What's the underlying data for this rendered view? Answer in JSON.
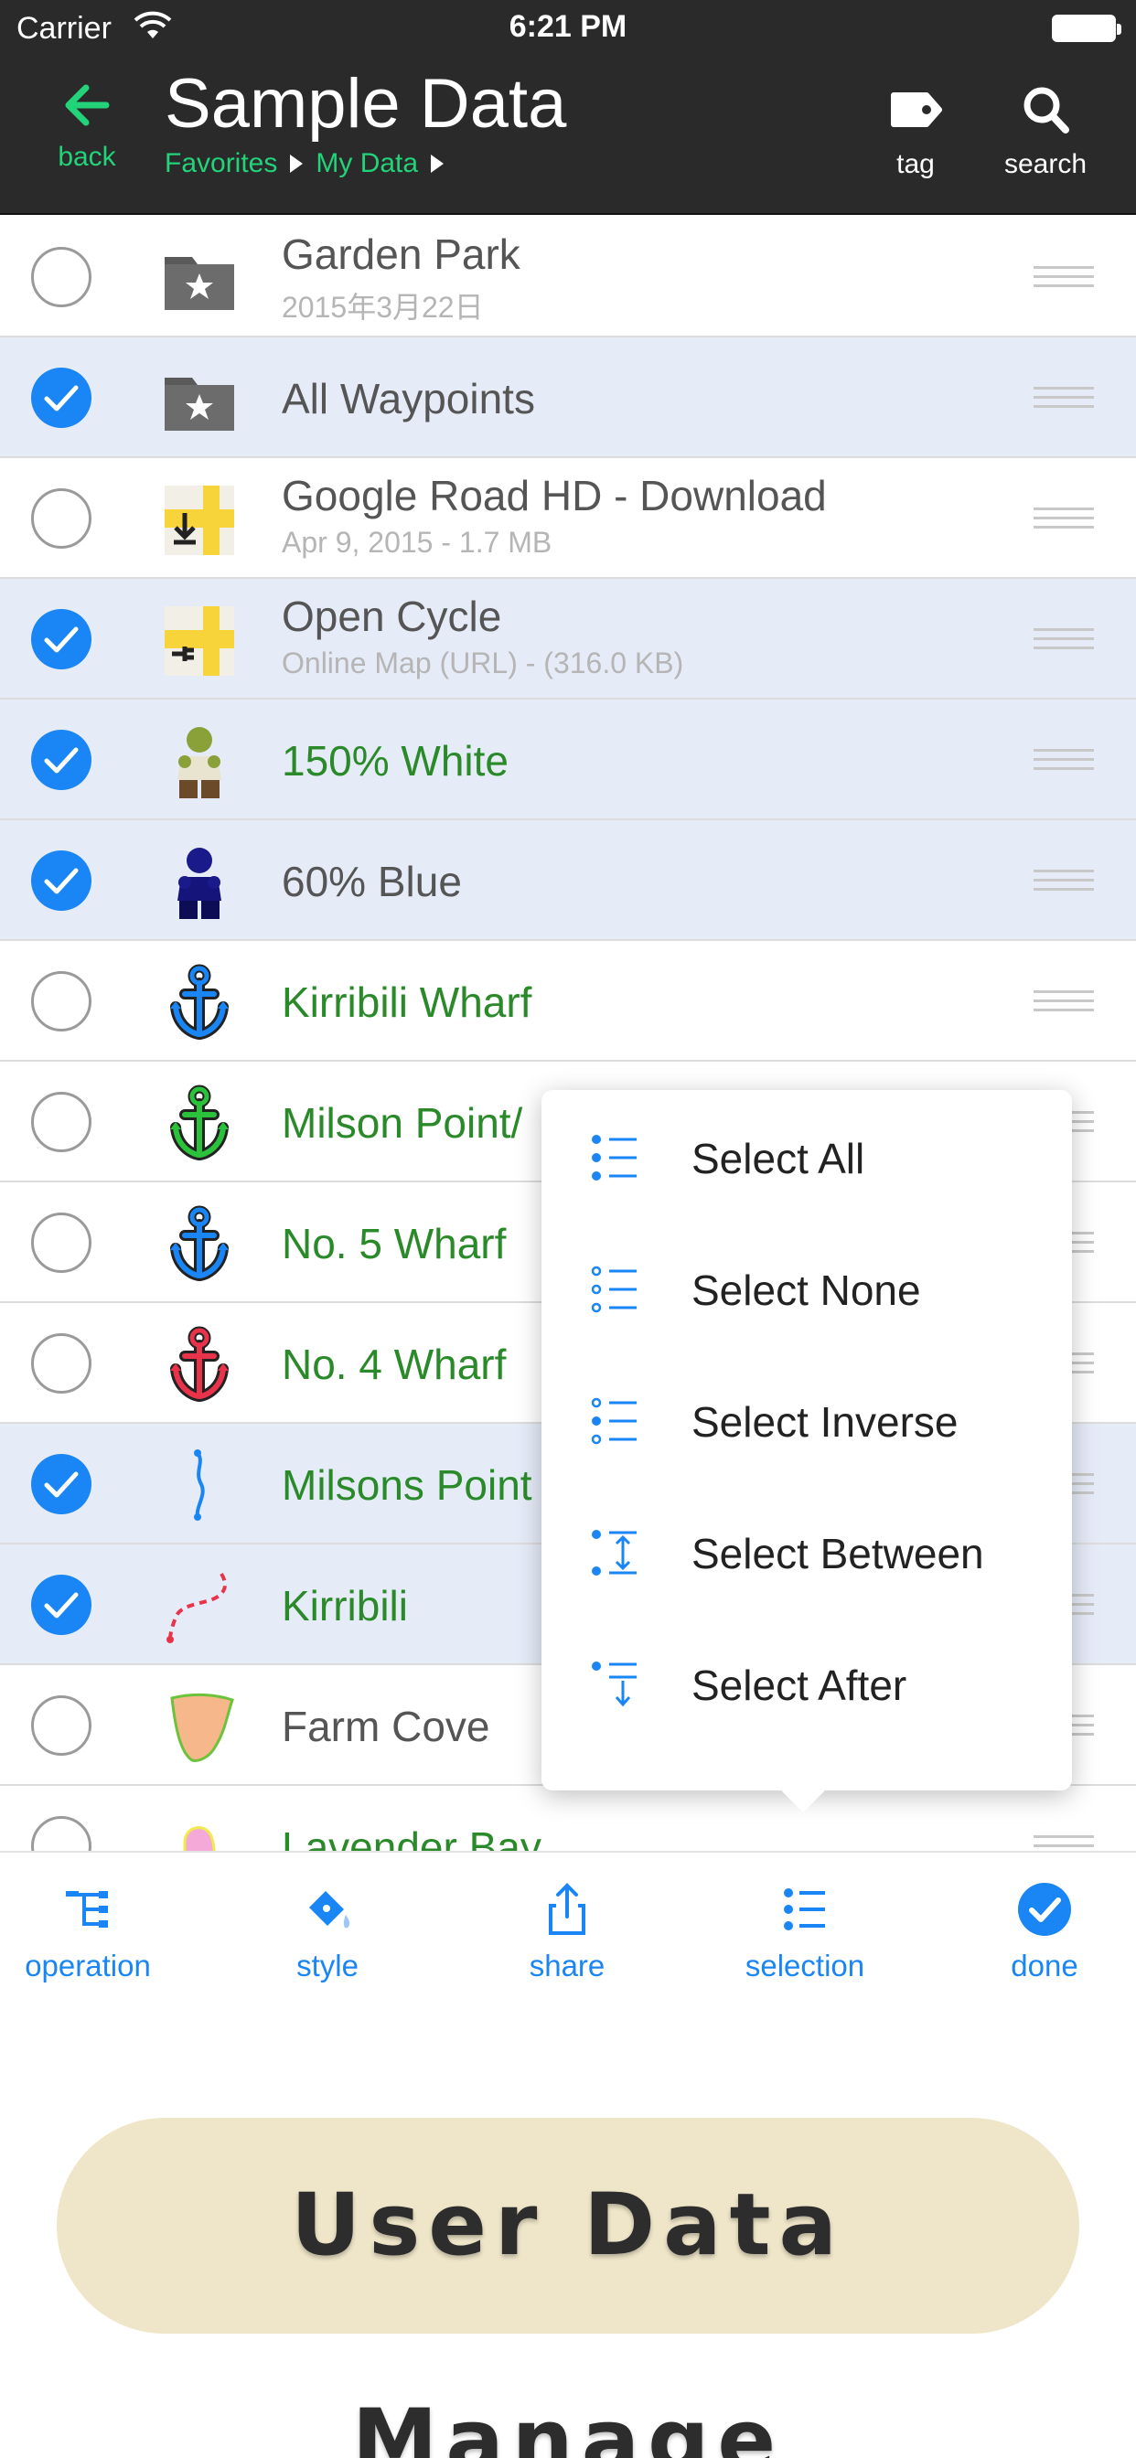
{
  "status_bar": {
    "carrier": "Carrier",
    "time": "6:21 PM"
  },
  "header": {
    "title": "Sample Data",
    "back_label": "back",
    "breadcrumbs": [
      "Favorites",
      "My Data"
    ],
    "tag_label": "tag",
    "search_label": "search"
  },
  "list": {
    "rows": [
      {
        "name": "Garden Park",
        "sub": "2015年3月22日",
        "selected": false,
        "color": "gray",
        "icon": "folder-star-icon"
      },
      {
        "name": "All Waypoints",
        "sub": "",
        "selected": true,
        "color": "gray",
        "icon": "folder-star-icon"
      },
      {
        "name": "Google Road HD - Download",
        "sub": "Apr 9, 2015 - 1.7 MB",
        "selected": false,
        "color": "gray",
        "icon": "map-download-icon"
      },
      {
        "name": "Open Cycle",
        "sub": "Online Map (URL) - (316.0 KB)",
        "selected": true,
        "color": "gray",
        "icon": "map-online-icon"
      },
      {
        "name": "150% White",
        "sub": "",
        "selected": true,
        "color": "green",
        "icon": "ogre-icon"
      },
      {
        "name": "60% Blue",
        "sub": "",
        "selected": true,
        "color": "gray",
        "icon": "ogre-blue-icon"
      },
      {
        "name": "Kirribili Wharf",
        "sub": "",
        "selected": false,
        "color": "green",
        "icon": "anchor-blue-icon"
      },
      {
        "name": "Milson Point/",
        "sub": "",
        "selected": false,
        "color": "green",
        "icon": "anchor-green-icon"
      },
      {
        "name": "No. 5 Wharf",
        "sub": "",
        "selected": false,
        "color": "green",
        "icon": "anchor-blue-icon"
      },
      {
        "name": "No. 4 Wharf",
        "sub": "",
        "selected": false,
        "color": "green",
        "icon": "anchor-red-icon"
      },
      {
        "name": "Milsons Point",
        "sub": "",
        "selected": true,
        "color": "green",
        "icon": "track-line-icon"
      },
      {
        "name": "Kirribili",
        "sub": "",
        "selected": true,
        "color": "green",
        "icon": "track-dashed-icon"
      },
      {
        "name": "Farm Cove",
        "sub": "",
        "selected": false,
        "color": "gray",
        "icon": "area-orange-icon"
      },
      {
        "name": "Lavender Bay",
        "sub": "",
        "selected": false,
        "color": "green",
        "icon": "area-pink-icon"
      }
    ]
  },
  "selection_menu": {
    "items": [
      "Select All",
      "Select None",
      "Select Inverse",
      "Select Between",
      "Select After"
    ]
  },
  "toolbar": {
    "operation": "operation",
    "style": "style",
    "share": "share",
    "selection": "selection",
    "done": "done"
  },
  "banner": {
    "text": "User Data Manage"
  },
  "colors": {
    "header_bg": "#2a2a2a",
    "accent_green": "#22d37a",
    "accent_blue": "#1a86f5",
    "selected_row": "#e6ebf8",
    "banner_bg": "#efe6c9"
  }
}
